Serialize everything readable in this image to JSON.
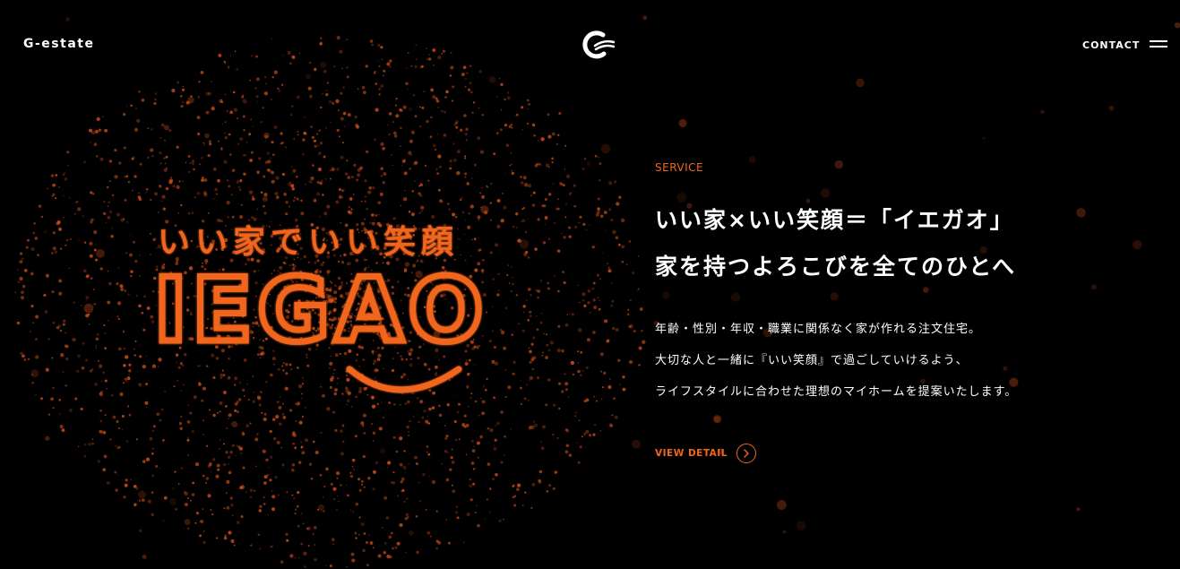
{
  "header": {
    "brand": "G-estate",
    "logo_icon": "g-estate-logo-icon",
    "contact_label": "CONTACT",
    "menu_icon": "hamburger-menu-icon"
  },
  "visual": {
    "tagline": "いい家でいい笑顔",
    "logo_text": "IEGAO",
    "style": "orange particle lettering with smile curve on black",
    "accent": "#f2651c"
  },
  "section": {
    "label": "SERVICE",
    "headline": [
      "いい家×いい笑顔＝「イエガオ」",
      "家を持つよろこびを全てのひとへ"
    ],
    "body": [
      "年齢・性別・年収・職業に関係なく家が作れる注文住宅。",
      "大切な人と一緒に『いい笑顔』で過ごしていけるよう、",
      "ライフスタイルに合わせた理想のマイホームを提案いたします。"
    ],
    "cta_label": "VIEW DETAIL",
    "cta_icon": "chevron-right-circle-icon"
  },
  "colors": {
    "background": "#000000",
    "text": "#ffffff",
    "accent": "#f2651c"
  }
}
